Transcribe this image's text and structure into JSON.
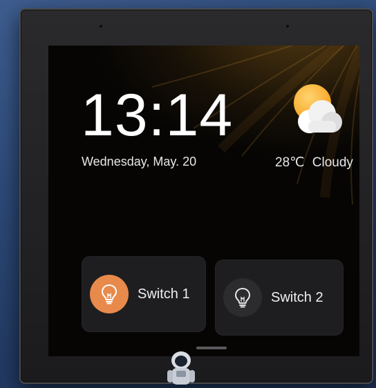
{
  "clock": {
    "time": "13:14",
    "date": "Wednesday, May. 20"
  },
  "weather": {
    "temperature": "28℃",
    "condition": "Cloudy",
    "icon": "partly-cloudy-icon"
  },
  "switches": [
    {
      "label": "Switch 1",
      "state": "on",
      "icon": "lightbulb-icon",
      "color": "#e88a4c"
    },
    {
      "label": "Switch 2",
      "state": "off",
      "icon": "lightbulb-icon",
      "color": "#2c2c2f"
    }
  ],
  "colors": {
    "accent": "#e88a4c",
    "screen_bg": "#060504",
    "card_bg": "#1e1e20"
  }
}
